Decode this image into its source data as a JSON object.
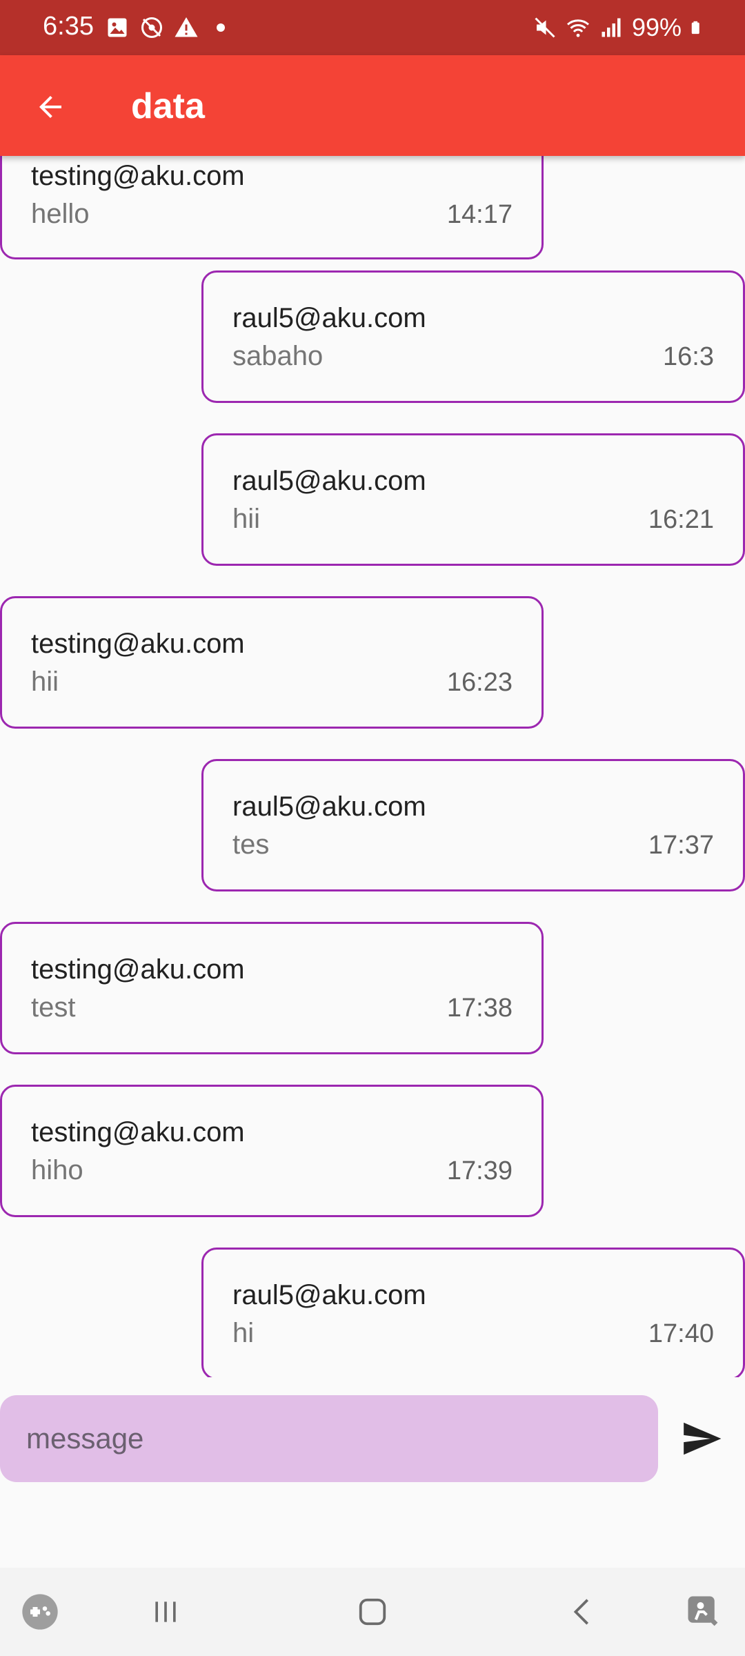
{
  "status_bar": {
    "time": "6:35",
    "battery": "99%",
    "left_icons": [
      "image-icon",
      "eye-off-icon",
      "warning-icon",
      "dot-icon"
    ],
    "right_icons": [
      "mute-icon",
      "wifi-icon",
      "signal-icon",
      "battery-icon"
    ]
  },
  "app_bar": {
    "title": "data",
    "back_icon": "arrow-back-icon",
    "color": "#f44336"
  },
  "messages": [
    {
      "side": "left",
      "sender": "testing@aku.com",
      "text": "hello",
      "time": "14:17"
    },
    {
      "side": "right",
      "sender": "raul5@aku.com",
      "text": "sabaho",
      "time": "16:3"
    },
    {
      "side": "right",
      "sender": "raul5@aku.com",
      "text": "hii",
      "time": "16:21"
    },
    {
      "side": "left",
      "sender": "testing@aku.com",
      "text": "hii",
      "time": "16:23"
    },
    {
      "side": "right",
      "sender": "raul5@aku.com",
      "text": "tes",
      "time": "17:37"
    },
    {
      "side": "left",
      "sender": "testing@aku.com",
      "text": "test",
      "time": "17:38"
    },
    {
      "side": "left",
      "sender": "testing@aku.com",
      "text": "hiho",
      "time": "17:39"
    },
    {
      "side": "right",
      "sender": "raul5@aku.com",
      "text": "hi",
      "time": "17:40"
    }
  ],
  "input": {
    "placeholder": "message",
    "value": "",
    "send_icon": "send-icon",
    "fill_color": "#e1bee7"
  },
  "bubble_border_color": "#9c27b0",
  "nav_bar": {
    "items": [
      "game-launcher-icon",
      "recent-apps-icon",
      "home-icon",
      "back-icon",
      "accessibility-icon"
    ]
  }
}
